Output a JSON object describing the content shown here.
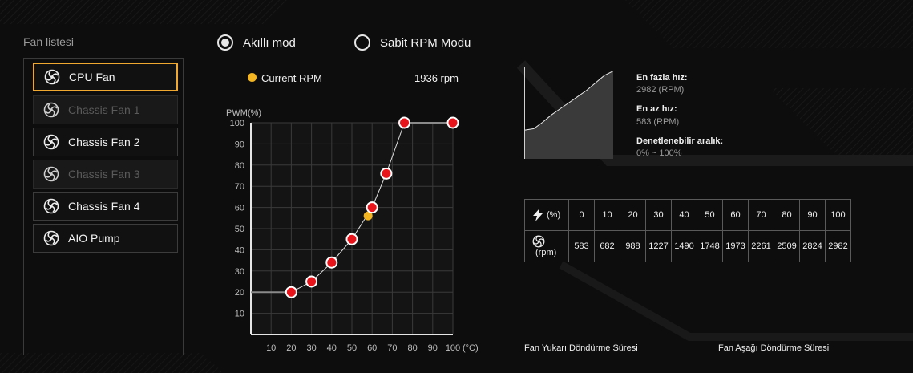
{
  "fan_list": {
    "title": "Fan listesi",
    "items": [
      {
        "label": "CPU Fan",
        "state": "selected"
      },
      {
        "label": "Chassis Fan 1",
        "state": "disabled"
      },
      {
        "label": "Chassis Fan 2",
        "state": "normal"
      },
      {
        "label": "Chassis Fan 3",
        "state": "disabled"
      },
      {
        "label": "Chassis Fan 4",
        "state": "normal"
      },
      {
        "label": "AIO Pump",
        "state": "normal"
      }
    ]
  },
  "mode": {
    "smart_label": "Akıllı mod",
    "fixed_label": "Sabit RPM Modu",
    "selected": "smart"
  },
  "current": {
    "label": "Current RPM",
    "value": "1936 rpm",
    "color": "#f3b622"
  },
  "chart_data": {
    "type": "line",
    "ylabel": "PWM(%)",
    "xlabel": "(°C)",
    "xlim": [
      0,
      100
    ],
    "ylim": [
      0,
      100
    ],
    "x_ticks": [
      "10",
      "20",
      "30",
      "40",
      "50",
      "60",
      "70",
      "80",
      "90",
      "100"
    ],
    "y_ticks": [
      "10",
      "20",
      "30",
      "40",
      "50",
      "60",
      "70",
      "80",
      "90",
      "100"
    ],
    "grid": true,
    "point_color": "#e8141b",
    "series": [
      {
        "x": [
          20,
          30,
          40,
          50,
          60,
          67,
          76,
          100
        ],
        "y": [
          20,
          25,
          34,
          45,
          60,
          76,
          100,
          100
        ]
      }
    ],
    "current_point": {
      "x": 58,
      "y": 56
    }
  },
  "info": {
    "max_label": "En fazla hız:",
    "max_value": "2982 (RPM)",
    "min_label": "En az hız:",
    "min_value": "583 (RPM)",
    "range_label": "Denetlenebilir aralık:",
    "range_value": "0% ~ 100%"
  },
  "spark_data": {
    "y": [
      583,
      640,
      900,
      1200,
      1450,
      1700,
      1950,
      2200,
      2500,
      2800,
      2982
    ]
  },
  "rpm_table": {
    "pwm_unit": "(%)",
    "rpm_unit": "(rpm)",
    "pwm": [
      "0",
      "10",
      "20",
      "30",
      "40",
      "50",
      "60",
      "70",
      "80",
      "90",
      "100"
    ],
    "rpm": [
      "583",
      "682",
      "988",
      "1227",
      "1490",
      "1748",
      "1973",
      "2261",
      "2509",
      "2824",
      "2982"
    ]
  },
  "footer": {
    "spin_up": "Fan Yukarı Döndürme Süresi",
    "spin_down": "Fan Aşağı Döndürme Süresi"
  }
}
